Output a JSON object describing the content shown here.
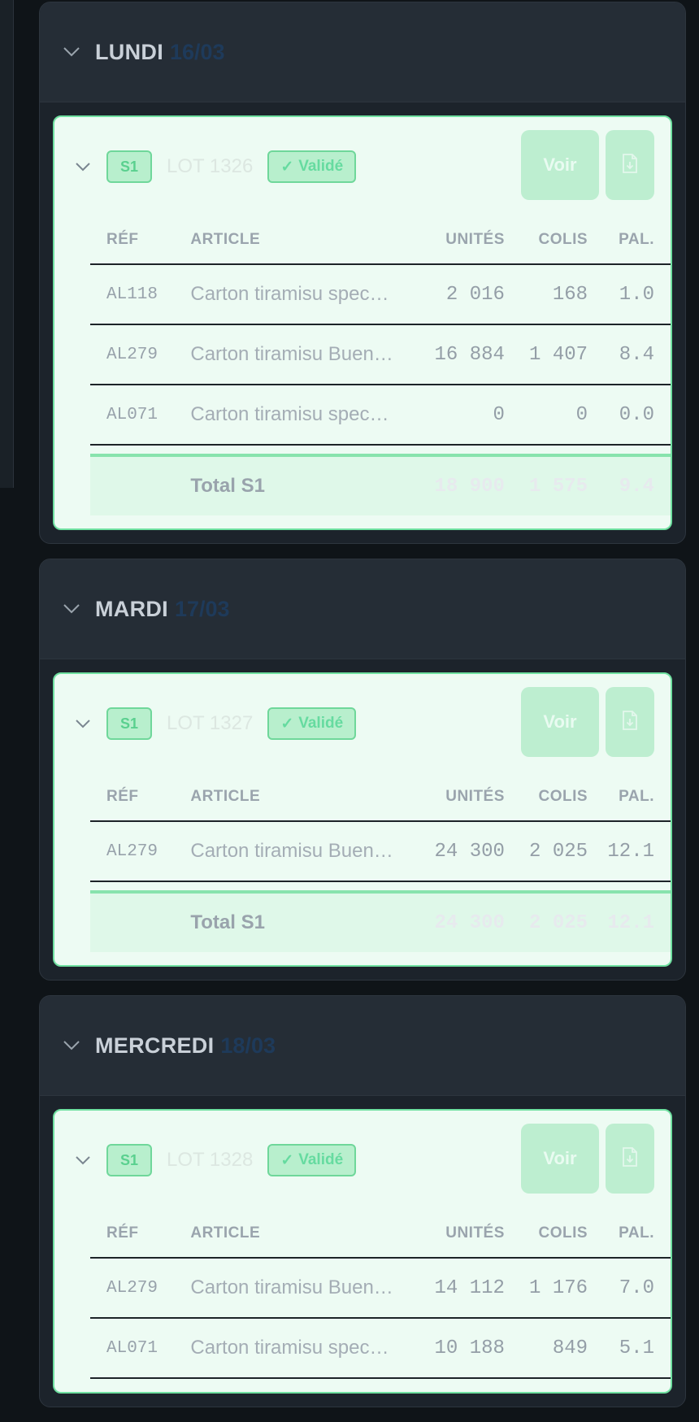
{
  "days": [
    {
      "name": "LUNDI",
      "date": "16/03",
      "lot": {
        "shift": "S1",
        "lot_label": "LOT 1326",
        "status": "Validé",
        "voir": "Voir",
        "headers": {
          "ref": "RÉF",
          "article": "ARTICLE",
          "units": "UNITÉS",
          "colis": "COLIS",
          "pal": "PAL."
        },
        "rows": [
          {
            "ref": "AL118",
            "article": "Carton tiramisu spec…",
            "units": "2 016",
            "colis": "168",
            "pal": "1.0"
          },
          {
            "ref": "AL279",
            "article": "Carton tiramisu Buen…",
            "units": "16 884",
            "colis": "1 407",
            "pal": "8.4"
          },
          {
            "ref": "AL071",
            "article": "Carton tiramisu spec…",
            "units": "0",
            "colis": "0",
            "pal": "0.0"
          }
        ],
        "total": {
          "label": "Total S1",
          "units": "18 900",
          "colis": "1 575",
          "pal": "9.4"
        }
      }
    },
    {
      "name": "MARDI",
      "date": "17/03",
      "lot": {
        "shift": "S1",
        "lot_label": "LOT 1327",
        "status": "Validé",
        "voir": "Voir",
        "headers": {
          "ref": "RÉF",
          "article": "ARTICLE",
          "units": "UNITÉS",
          "colis": "COLIS",
          "pal": "PAL."
        },
        "rows": [
          {
            "ref": "AL279",
            "article": "Carton tiramisu Buen…",
            "units": "24 300",
            "colis": "2 025",
            "pal": "12.1"
          }
        ],
        "total": {
          "label": "Total S1",
          "units": "24 300",
          "colis": "2 025",
          "pal": "12.1"
        }
      }
    },
    {
      "name": "MERCREDI",
      "date": "18/03",
      "lot": {
        "shift": "S1",
        "lot_label": "LOT 1328",
        "status": "Validé",
        "voir": "Voir",
        "headers": {
          "ref": "RÉF",
          "article": "ARTICLE",
          "units": "UNITÉS",
          "colis": "COLIS",
          "pal": "PAL."
        },
        "rows": [
          {
            "ref": "AL279",
            "article": "Carton tiramisu Buen…",
            "units": "14 112",
            "colis": "1 176",
            "pal": "7.0"
          },
          {
            "ref": "AL071",
            "article": "Carton tiramisu spec…",
            "units": "10 188",
            "colis": "849",
            "pal": "5.1"
          }
        ],
        "total": null
      }
    }
  ],
  "icons": {
    "chevron": "chevron-down-icon",
    "download": "file-download-icon",
    "check": "check-icon"
  },
  "colors": {
    "accent_green": "#6fe0a0",
    "day_date": "#1e3a5a",
    "panel": "#1c232b"
  }
}
